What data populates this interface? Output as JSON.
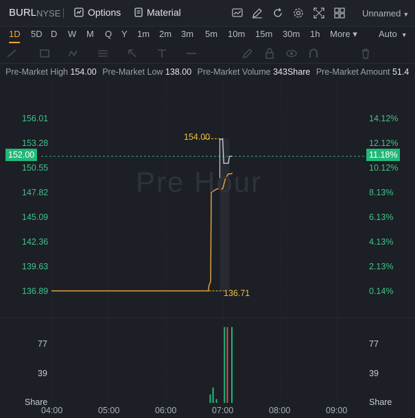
{
  "header": {
    "ticker": "BURL",
    "exchange": "NYSE",
    "options_label": "Options",
    "material_label": "Material",
    "layout_label": "Unnamed"
  },
  "timeframes": [
    "1D",
    "5D",
    "D",
    "W",
    "M",
    "Q",
    "Y",
    "1m",
    "2m",
    "3m",
    "5m",
    "10m",
    "15m",
    "30m",
    "1h",
    "More"
  ],
  "active_timeframe": "1D",
  "scale_label": "Auto",
  "info": {
    "high_label": "Pre-Market High",
    "high_value": "154.00",
    "low_label": "Pre-Market Low",
    "low_value": "138.00",
    "volume_label": "Pre-Market Volume",
    "volume_value": "343Share",
    "amount_label": "Pre-Market Amount",
    "amount_value": "51.4"
  },
  "chart": {
    "watermark": "Pre Hour",
    "current_price": "152.00",
    "current_pct": "11.18%",
    "high_marker": "154.00",
    "low_marker": "136.71",
    "volume_unit": "Share",
    "price_labels": [
      "156.01",
      "153.28",
      "150.55",
      "147.82",
      "145.09",
      "142.36",
      "139.63",
      "136.89"
    ],
    "pct_labels": [
      "14.12%",
      "12.12%",
      "10.12%",
      "8.13%",
      "6.13%",
      "4.13%",
      "2.13%",
      "0.14%"
    ],
    "volume_labels": [
      "77",
      "39"
    ],
    "time_labels": [
      "04:00",
      "05:00",
      "06:00",
      "07:00",
      "08:00",
      "09:00"
    ],
    "colors": {
      "up": "#21b979",
      "down": "#e0474c",
      "accent": "#f2a93b",
      "price_line": "#e8a040"
    }
  },
  "chart_data": {
    "type": "line",
    "ylim": [
      135.5,
      157.3
    ],
    "x_hours": [
      "04:00",
      "05:00",
      "06:00",
      "07:00",
      "08:00",
      "09:00"
    ],
    "series": [
      {
        "values": [
          [
            4.0,
            136.71
          ],
          [
            6.75,
            136.71
          ],
          [
            6.76,
            137.3
          ],
          [
            6.79,
            137.8
          ],
          [
            6.8,
            147.9
          ],
          [
            6.9,
            148.3
          ],
          [
            7.0,
            148.3
          ],
          [
            7.05,
            149.5
          ],
          [
            7.1,
            150.0
          ],
          [
            7.15,
            150.0
          ],
          [
            7.17,
            150.1
          ]
        ]
      }
    ],
    "volume": [
      {
        "t": 6.77,
        "v": 11,
        "dir": "up"
      },
      {
        "t": 6.82,
        "v": 20,
        "dir": "up"
      },
      {
        "t": 6.88,
        "v": 5,
        "dir": "up"
      },
      {
        "t": 7.02,
        "v": 98,
        "dir": "up"
      },
      {
        "t": 7.07,
        "v": 98,
        "dir": "down"
      },
      {
        "t": 7.15,
        "v": 98,
        "dir": "up"
      }
    ]
  }
}
